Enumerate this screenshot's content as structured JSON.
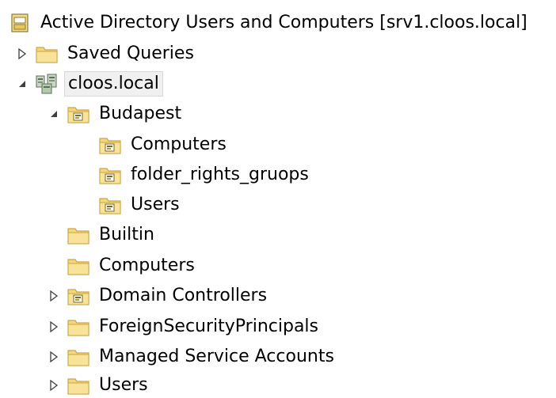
{
  "tree": {
    "root": {
      "label": "Active Directory Users and Computers [srv1.cloos.local]",
      "icon": "aduc-console-icon"
    },
    "saved_queries": {
      "label": "Saved Queries",
      "icon": "folder-icon",
      "expander": "collapsed"
    },
    "domain": {
      "label": "cloos.local",
      "icon": "domain-icon",
      "expander": "expanded"
    },
    "budapest": {
      "label": "Budapest",
      "icon": "ou-folder-icon",
      "expander": "expanded"
    },
    "budapest_computers": {
      "label": "Computers",
      "icon": "ou-folder-icon"
    },
    "folder_rights": {
      "label": "folder_rights_gruops",
      "icon": "ou-folder-icon"
    },
    "budapest_users": {
      "label": "Users",
      "icon": "ou-folder-icon"
    },
    "builtin": {
      "label": "Builtin",
      "icon": "folder-icon"
    },
    "computers": {
      "label": "Computers",
      "icon": "folder-icon"
    },
    "domain_controllers": {
      "label": "Domain Controllers",
      "icon": "ou-folder-icon",
      "expander": "collapsed"
    },
    "fsp": {
      "label": "ForeignSecurityPrincipals",
      "icon": "folder-icon",
      "expander": "collapsed"
    },
    "msa": {
      "label": "Managed Service Accounts",
      "icon": "folder-icon",
      "expander": "collapsed"
    },
    "users": {
      "label": "Users",
      "icon": "folder-icon",
      "expander": "collapsed"
    }
  },
  "colors": {
    "folder_fill": "#f5d67a",
    "folder_stroke": "#c9a646",
    "selection_bg": "#f0f0f0",
    "selection_border": "#d9d9d9"
  }
}
